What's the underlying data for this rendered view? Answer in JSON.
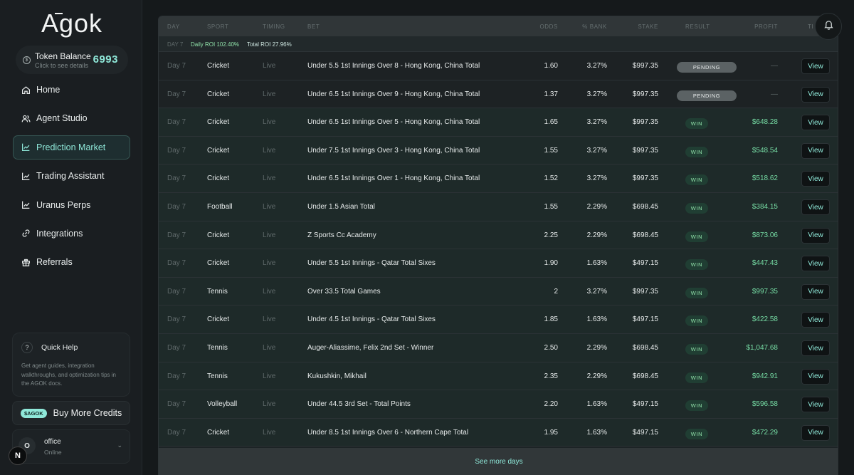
{
  "app": {
    "logo": "Agok"
  },
  "token": {
    "label": "Token Balance",
    "sub": "Click to see details",
    "value": "6993"
  },
  "nav": [
    {
      "label": "Home",
      "icon": "home-icon"
    },
    {
      "label": "Agent Studio",
      "icon": "users-icon"
    },
    {
      "label": "Prediction Market",
      "icon": "chart-line-icon",
      "active": true
    },
    {
      "label": "Trading Assistant",
      "icon": "chart-line-icon"
    },
    {
      "label": "Uranus Perps",
      "icon": "chart-line-icon"
    },
    {
      "label": "Integrations",
      "icon": "link-icon"
    },
    {
      "label": "Referrals",
      "icon": "gift-icon"
    }
  ],
  "help": {
    "title": "Quick Help",
    "desc": "Get agent guides, integration walkthroughs, and optimization tips in the AGOK docs."
  },
  "buy": {
    "pill": "$AGOK",
    "label": "Buy More Credits"
  },
  "user": {
    "initial": "O",
    "name": "office",
    "status": "Online"
  },
  "badge": "N",
  "table": {
    "headers": {
      "day": "DAY",
      "sport": "SPORT",
      "timing": "TIMING",
      "bet": "BET",
      "odds": "ODDS",
      "bank": "% BANK",
      "stake": "STAKE",
      "result": "RESULT",
      "profit": "PROFIT",
      "tail": "TI"
    },
    "summary": {
      "day": "DAY 7",
      "daily": "Daily ROI 102.40%",
      "total": "Total ROI 27.96%"
    },
    "view_label": "View",
    "rows": [
      {
        "day": "Day 7",
        "sport": "Cricket",
        "timing": "Live",
        "bet": "Under 5.5 1st Innings Over 8 - Hong Kong, China Total",
        "odds": "1.60",
        "bank": "3.27%",
        "stake": "$997.35",
        "result": "PENDING",
        "profit": "—"
      },
      {
        "day": "Day 7",
        "sport": "Cricket",
        "timing": "Live",
        "bet": "Under 6.5 1st Innings Over 9 - Hong Kong, China Total",
        "odds": "1.37",
        "bank": "3.27%",
        "stake": "$997.35",
        "result": "PENDING",
        "profit": "—"
      },
      {
        "day": "Day 7",
        "sport": "Cricket",
        "timing": "Live",
        "bet": "Under 6.5 1st Innings Over 5 - Hong Kong, China Total",
        "odds": "1.65",
        "bank": "3.27%",
        "stake": "$997.35",
        "result": "WIN",
        "profit": "$648.28"
      },
      {
        "day": "Day 7",
        "sport": "Cricket",
        "timing": "Live",
        "bet": "Under 7.5 1st Innings Over 3 - Hong Kong, China Total",
        "odds": "1.55",
        "bank": "3.27%",
        "stake": "$997.35",
        "result": "WIN",
        "profit": "$548.54"
      },
      {
        "day": "Day 7",
        "sport": "Cricket",
        "timing": "Live",
        "bet": "Under 6.5 1st Innings Over 1 - Hong Kong, China Total",
        "odds": "1.52",
        "bank": "3.27%",
        "stake": "$997.35",
        "result": "WIN",
        "profit": "$518.62"
      },
      {
        "day": "Day 7",
        "sport": "Football",
        "timing": "Live",
        "bet": "Under 1.5 Asian Total",
        "odds": "1.55",
        "bank": "2.29%",
        "stake": "$698.45",
        "result": "WIN",
        "profit": "$384.15"
      },
      {
        "day": "Day 7",
        "sport": "Cricket",
        "timing": "Live",
        "bet": "Z Sports Cc Academy",
        "odds": "2.25",
        "bank": "2.29%",
        "stake": "$698.45",
        "result": "WIN",
        "profit": "$873.06"
      },
      {
        "day": "Day 7",
        "sport": "Cricket",
        "timing": "Live",
        "bet": "Under 5.5 1st Innings - Qatar Total Sixes",
        "odds": "1.90",
        "bank": "1.63%",
        "stake": "$497.15",
        "result": "WIN",
        "profit": "$447.43"
      },
      {
        "day": "Day 7",
        "sport": "Tennis",
        "timing": "Live",
        "bet": "Over 33.5 Total Games",
        "odds": "2",
        "bank": "3.27%",
        "stake": "$997.35",
        "result": "WIN",
        "profit": "$997.35"
      },
      {
        "day": "Day 7",
        "sport": "Cricket",
        "timing": "Live",
        "bet": "Under 4.5 1st Innings - Qatar Total Sixes",
        "odds": "1.85",
        "bank": "1.63%",
        "stake": "$497.15",
        "result": "WIN",
        "profit": "$422.58"
      },
      {
        "day": "Day 7",
        "sport": "Tennis",
        "timing": "Live",
        "bet": "Auger-Aliassime, Felix 2nd Set - Winner",
        "odds": "2.50",
        "bank": "2.29%",
        "stake": "$698.45",
        "result": "WIN",
        "profit": "$1,047.68"
      },
      {
        "day": "Day 7",
        "sport": "Tennis",
        "timing": "Live",
        "bet": "Kukushkin, Mikhail",
        "odds": "2.35",
        "bank": "2.29%",
        "stake": "$698.45",
        "result": "WIN",
        "profit": "$942.91"
      },
      {
        "day": "Day 7",
        "sport": "Volleyball",
        "timing": "Live",
        "bet": "Under 44.5 3rd Set - Total Points",
        "odds": "2.20",
        "bank": "1.63%",
        "stake": "$497.15",
        "result": "WIN",
        "profit": "$596.58"
      },
      {
        "day": "Day 7",
        "sport": "Cricket",
        "timing": "Live",
        "bet": "Under 8.5 1st Innings Over 6 - Northern Cape Total",
        "odds": "1.95",
        "bank": "1.63%",
        "stake": "$497.15",
        "result": "WIN",
        "profit": "$472.29"
      }
    ],
    "more_label": "See more days"
  },
  "colors": {
    "accent": "#8fe8d9",
    "win": "#8fe0a8",
    "profit": "#76dca4",
    "pending": "#5b6264"
  }
}
